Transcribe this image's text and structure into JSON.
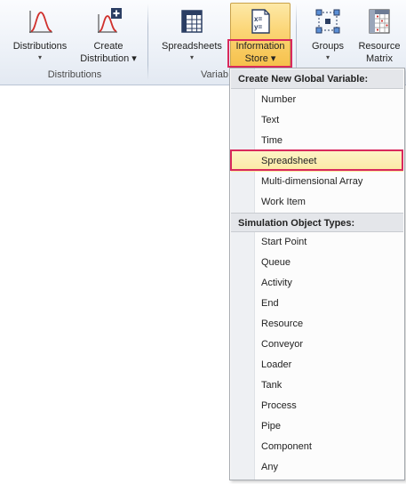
{
  "ribbon": {
    "buttons": {
      "distributions": {
        "line1": "Distributions",
        "arrow": "▾",
        "icon": "distribution-curve-icon"
      },
      "create_distribution": {
        "line1": "Create",
        "line2": "Distribution ▾",
        "icon": "create-distribution-icon"
      },
      "spreadsheets": {
        "line1": "Spreadsheets",
        "arrow": "▾",
        "icon": "spreadsheet-grid-icon"
      },
      "information_store": {
        "line1": "Information",
        "line2": "Store ▾",
        "icon": "xy-equation-icon"
      },
      "groups": {
        "line1": "Groups",
        "arrow": "▾",
        "icon": "groups-nodes-icon"
      },
      "resource_matrix": {
        "line1": "Resource",
        "line2": "Matrix",
        "icon": "resource-matrix-icon"
      }
    },
    "groups": {
      "distributions": "Distributions",
      "variables": "Variab"
    }
  },
  "menu": {
    "section1_title": "Create New Global Variable:",
    "section1_items": [
      "Number",
      "Text",
      "Time",
      "Spreadsheet",
      "Multi-dimensional Array",
      "Work Item"
    ],
    "section2_title": "Simulation Object Types:",
    "section2_items": [
      "Start Point",
      "Queue",
      "Activity",
      "End",
      "Resource",
      "Conveyor",
      "Loader",
      "Tank",
      "Process",
      "Pipe",
      "Component",
      "Any"
    ],
    "selected_item": "Spreadsheet"
  },
  "colors": {
    "highlight_border": "#d9295d",
    "active_button": "#fbd575",
    "selected_item": "#fbe9a2",
    "curve_red": "#d0312d"
  }
}
